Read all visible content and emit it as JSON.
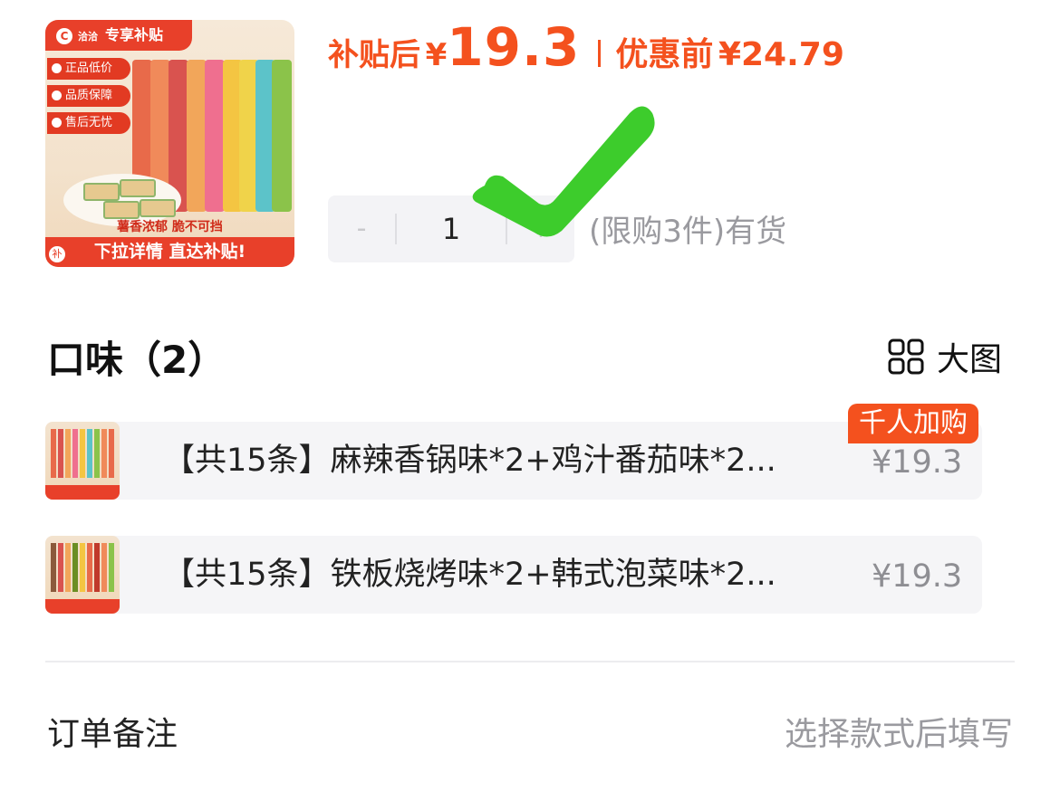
{
  "product": {
    "badge": "专享补贴",
    "brand": "洽洽",
    "tags": [
      "正品低价",
      "品质保障",
      "售后无忧"
    ],
    "slogan": "薯香浓郁 脆不可挡",
    "cta": "下拉详情 直达补贴!",
    "corner": "补"
  },
  "price": {
    "after_label": "补贴后",
    "currency": "¥",
    "after_value": "19.3",
    "before_label": "优惠前",
    "before_value": "¥24.79",
    "color": "#f4511e"
  },
  "quantity": {
    "minus": "-",
    "value": "1",
    "plus": "+",
    "stock_text": "(限购3件)有货"
  },
  "flavor": {
    "title": "口味（2）",
    "view_label": "大图",
    "view_icon": "grid-icon",
    "options": [
      {
        "name": "【共15条】麻辣香锅味*2+鸡汁番茄味*2...",
        "price": "¥19.3",
        "badge": "千人加购"
      },
      {
        "name": "【共15条】铁板烧烤味*2+韩式泡菜味*2...",
        "price": "¥19.3"
      }
    ]
  },
  "remark": {
    "label": "订单备注",
    "hint": "选择款式后填写"
  },
  "overlay": {
    "icon": "green-check-icon",
    "color": "#3dcc2c"
  }
}
